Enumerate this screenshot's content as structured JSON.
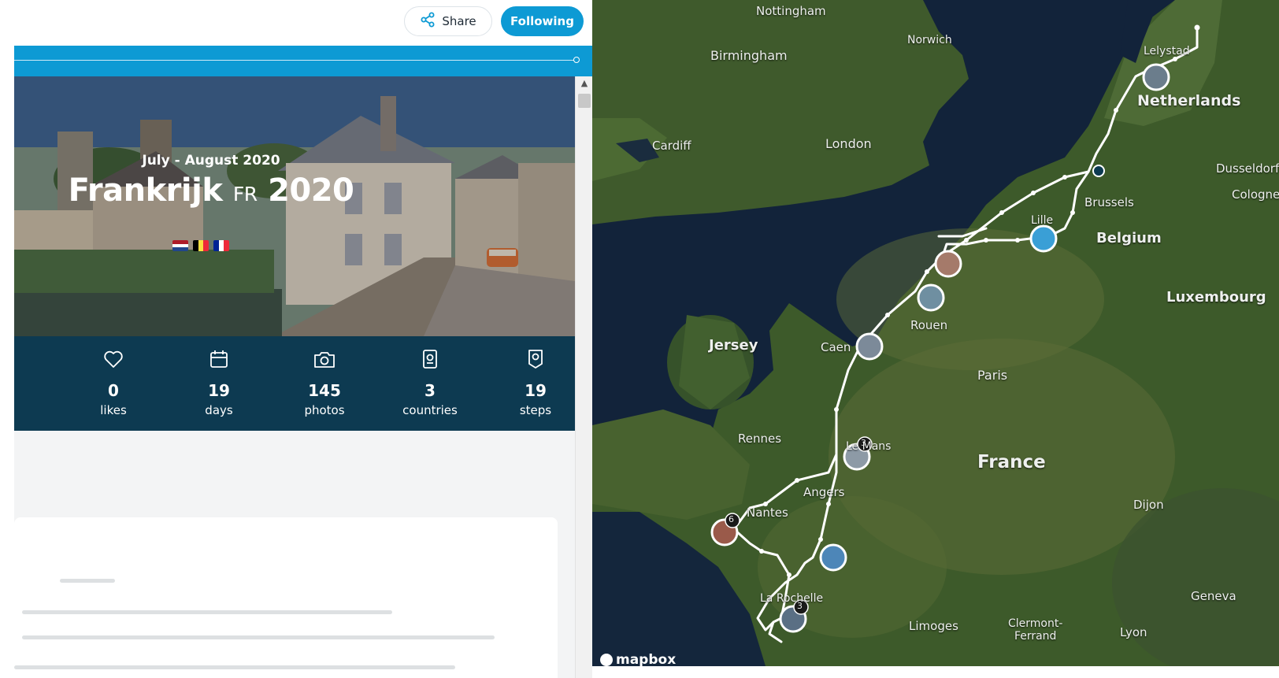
{
  "header": {
    "share_label": "Share",
    "following_label": "Following"
  },
  "trip": {
    "date_range": "July - August 2020",
    "title": "Frankrijk",
    "country_code": "FR",
    "year": "2020",
    "flags": [
      "netherlands",
      "belgium",
      "france"
    ]
  },
  "stats": [
    {
      "icon": "heart-icon",
      "value": "0",
      "label": "likes"
    },
    {
      "icon": "calendar-icon",
      "value": "19",
      "label": "days"
    },
    {
      "icon": "camera-icon",
      "value": "145",
      "label": "photos"
    },
    {
      "icon": "passport-icon",
      "value": "3",
      "label": "countries"
    },
    {
      "icon": "map-pin-icon",
      "value": "19",
      "label": "steps"
    }
  ],
  "map": {
    "labels": {
      "nottingham": "Nottingham",
      "norwich": "Norwich",
      "birmingham": "Birmingham",
      "lelystad": "Lelystad",
      "netherlands": "Netherlands",
      "cardiff": "Cardiff",
      "london": "London",
      "dusseldorf": "Dusseldorf",
      "cologne": "Cologne",
      "brussels": "Brussels",
      "belgium": "Belgium",
      "lille": "Lille",
      "luxembourg": "Luxembourg",
      "rouen": "Rouen",
      "jersey": "Jersey",
      "caen": "Caen",
      "paris": "Paris",
      "rennes": "Rennes",
      "le_mans": "Le Mans",
      "france": "France",
      "angers": "Angers",
      "nantes": "Nantes",
      "dijon": "Dijon",
      "geneva": "Geneva",
      "la_rochelle": "La Rochelle",
      "limoges": "Limoges",
      "clermont": "Clermont-\nFerrand",
      "lyon": "Lyon"
    },
    "cluster_counts": {
      "le_mans": "3",
      "nantes": "6",
      "la_rochelle": "3"
    },
    "attribution": "mapbox"
  }
}
